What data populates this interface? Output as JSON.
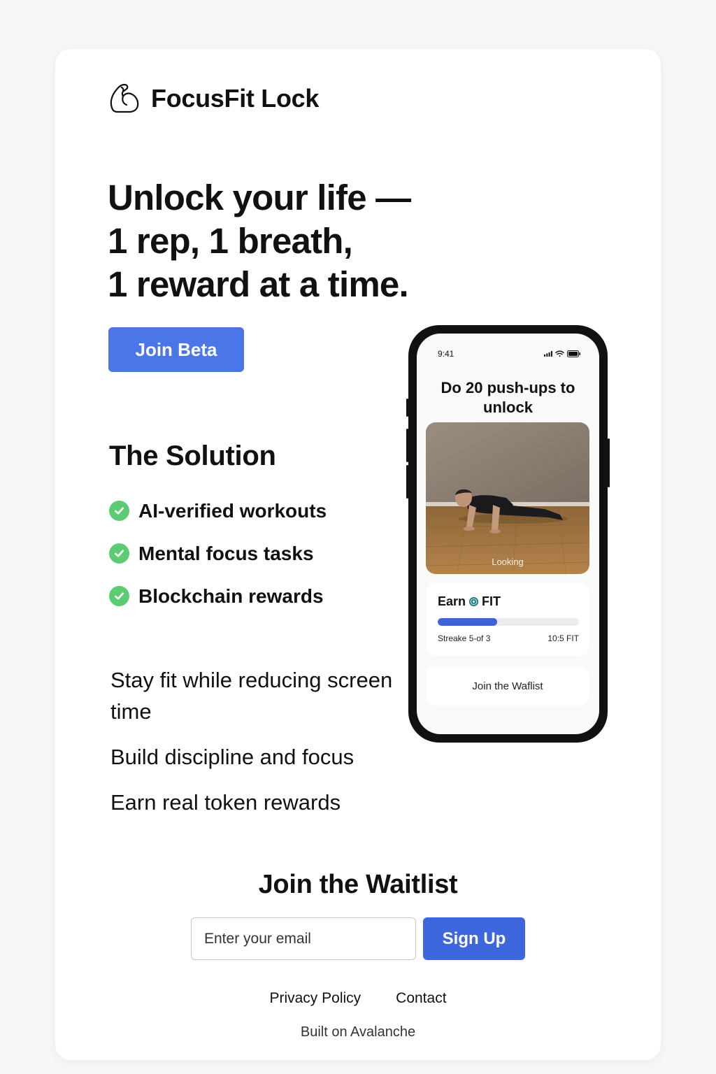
{
  "brand": {
    "name": "FocusFit Lock",
    "icon": "flexed-arm-icon"
  },
  "hero": {
    "lines": [
      "Unlock your life —",
      "1 rep, 1 breath,",
      "1 reward at a time."
    ],
    "cta_label": "Join Beta"
  },
  "solution": {
    "title": "The Solution",
    "items": [
      "AI-verified workouts",
      "Mental focus tasks",
      "Blockchain rewards"
    ],
    "check_color": "#5ccc72"
  },
  "benefits": [
    "Stay fit while reducing screen time",
    "Build discipline and focus",
    "Earn real token rewards"
  ],
  "phone": {
    "time": "9:41",
    "task": "Do 20 push-ups to unlock",
    "photo_label": "Looking",
    "earn": {
      "title": "Earn",
      "token": "FIT",
      "progress": 0.42,
      "streak_text": "Streake 5-of 3",
      "amount_text": "10:5 FIT"
    },
    "button_label": "Join the Waflist"
  },
  "waitlist": {
    "title": "Join the Waitlist",
    "email_placeholder": "Enter your email",
    "email_value": "",
    "signup_label": "Sign Up"
  },
  "footer": {
    "links": [
      "Privacy Policy",
      "Contact"
    ],
    "built_on": "Built on Avalanche"
  },
  "colors": {
    "accent": "#4a76e8",
    "signup": "#3e66dd",
    "progress": "#3e63d6",
    "check": "#5ccc72"
  }
}
